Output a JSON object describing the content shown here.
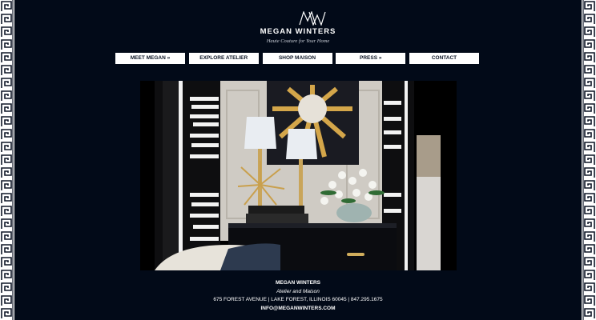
{
  "brand": {
    "logo_monogram": "MW",
    "name": "MEGAN WINTERS",
    "tagline": "Haute Couture for Your Home"
  },
  "nav": {
    "items": [
      {
        "label": "MEET MEGAN »"
      },
      {
        "label": "EXPLORE ATELIER"
      },
      {
        "label": "SHOP MAISON"
      },
      {
        "label": "PRESS »"
      },
      {
        "label": "CONTACT"
      }
    ]
  },
  "hero": {
    "alt_subject": "bedside vignette with lamps, starburst art, tulips"
  },
  "footer": {
    "name": "MEGAN WINTERS",
    "subtitle": "Atelier and Maison",
    "address": "675 FOREST AVENUE | LAKE FOREST, ILLINOIS 60045 | 847.295.1675",
    "email": "INFO@MEGANWINTERS.COM"
  },
  "colors": {
    "background": "#020a18",
    "border": "#ffffff",
    "nav_button_bg": "#ffffff",
    "nav_button_text": "#0b1424"
  },
  "icons": {
    "border_pattern": "greek-key-icon",
    "logo": "mw-monogram-icon"
  }
}
